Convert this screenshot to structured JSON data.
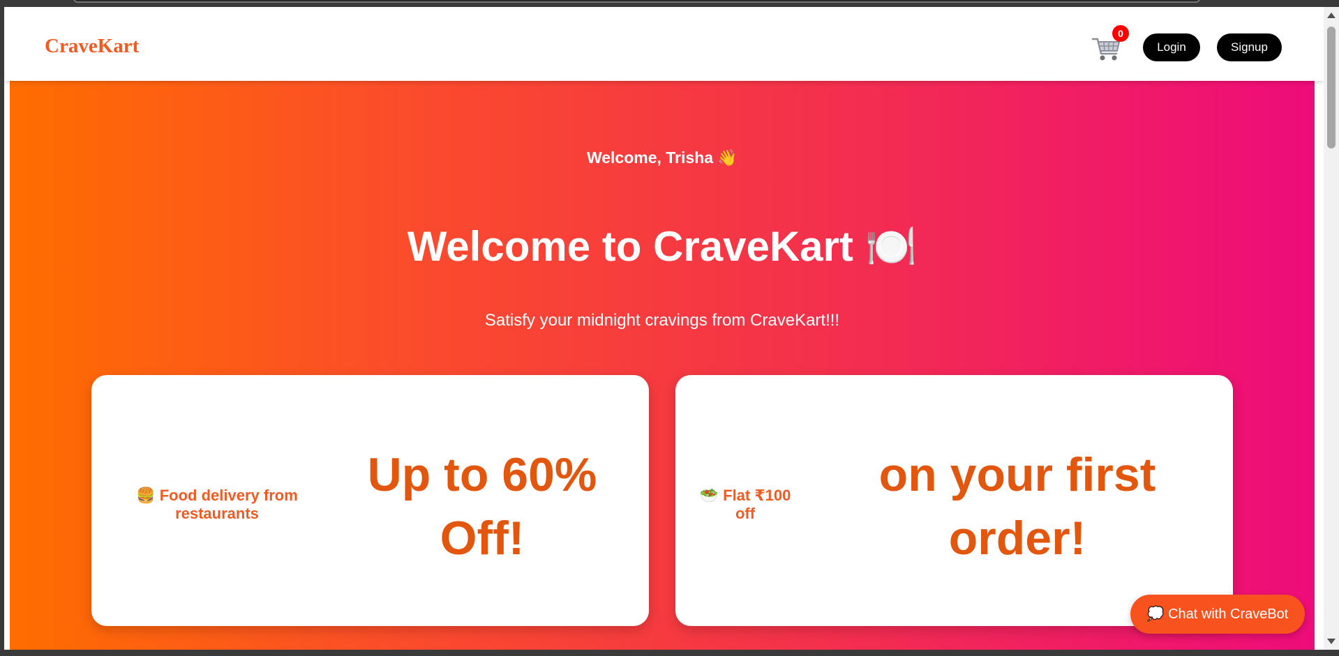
{
  "navbar": {
    "logo": "CraveKart",
    "cart_icon": "shopping-cart-icon",
    "cart_count": "0",
    "login_label": "Login",
    "signup_label": "Signup"
  },
  "hero": {
    "welcome_user": "Welcome, Trisha 👋",
    "title": "Welcome to CraveKart 🍽️",
    "subtitle": "Satisfy your midnight cravings from CraveKart!!!",
    "gradient": [
      "#ff6d00",
      "#ee0c7a"
    ]
  },
  "cards": [
    {
      "label": "🍔 Food delivery from restaurants",
      "promo": "Up to 60% Off!"
    },
    {
      "label": "🥗 Flat ₹100 off",
      "promo": "on your first order!"
    }
  ],
  "chatbot": {
    "label": "💭 Chat with CraveBot"
  },
  "colors": {
    "brand": "#f25a22",
    "promo_text": "#e3560d",
    "badge": "#ff0000"
  }
}
